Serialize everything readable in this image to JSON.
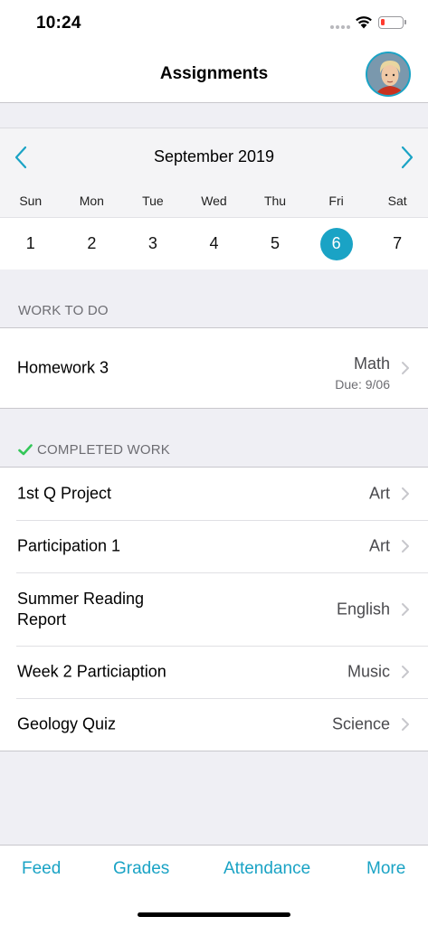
{
  "status_bar": {
    "time": "10:24",
    "battery_level": 0.18,
    "battery_color": "#ff3b30"
  },
  "nav": {
    "title": "Assignments"
  },
  "colors": {
    "accent": "#1aa3c5",
    "completed_check": "#34c759"
  },
  "calendar": {
    "month": "September 2019",
    "weekdays": [
      "Sun",
      "Mon",
      "Tue",
      "Wed",
      "Thu",
      "Fri",
      "Sat"
    ],
    "dates": [
      "1",
      "2",
      "3",
      "4",
      "5",
      "6",
      "7"
    ],
    "selected": "6"
  },
  "work_to_do": {
    "header": "WORK TO DO",
    "items": [
      {
        "title": "Homework 3",
        "subject": "Math",
        "due": "Due: 9/06"
      }
    ]
  },
  "completed": {
    "header": "COMPLETED WORK",
    "items": [
      {
        "title": "1st Q Project",
        "subject": "Art"
      },
      {
        "title": "Participation 1",
        "subject": "Art"
      },
      {
        "title": "Summer Reading Report",
        "subject": "English"
      },
      {
        "title": "Week 2 Particiaption",
        "subject": "Music"
      },
      {
        "title": "Geology Quiz",
        "subject": "Science"
      }
    ]
  },
  "tabs": [
    "Feed",
    "Grades",
    "Attendance",
    "More"
  ]
}
